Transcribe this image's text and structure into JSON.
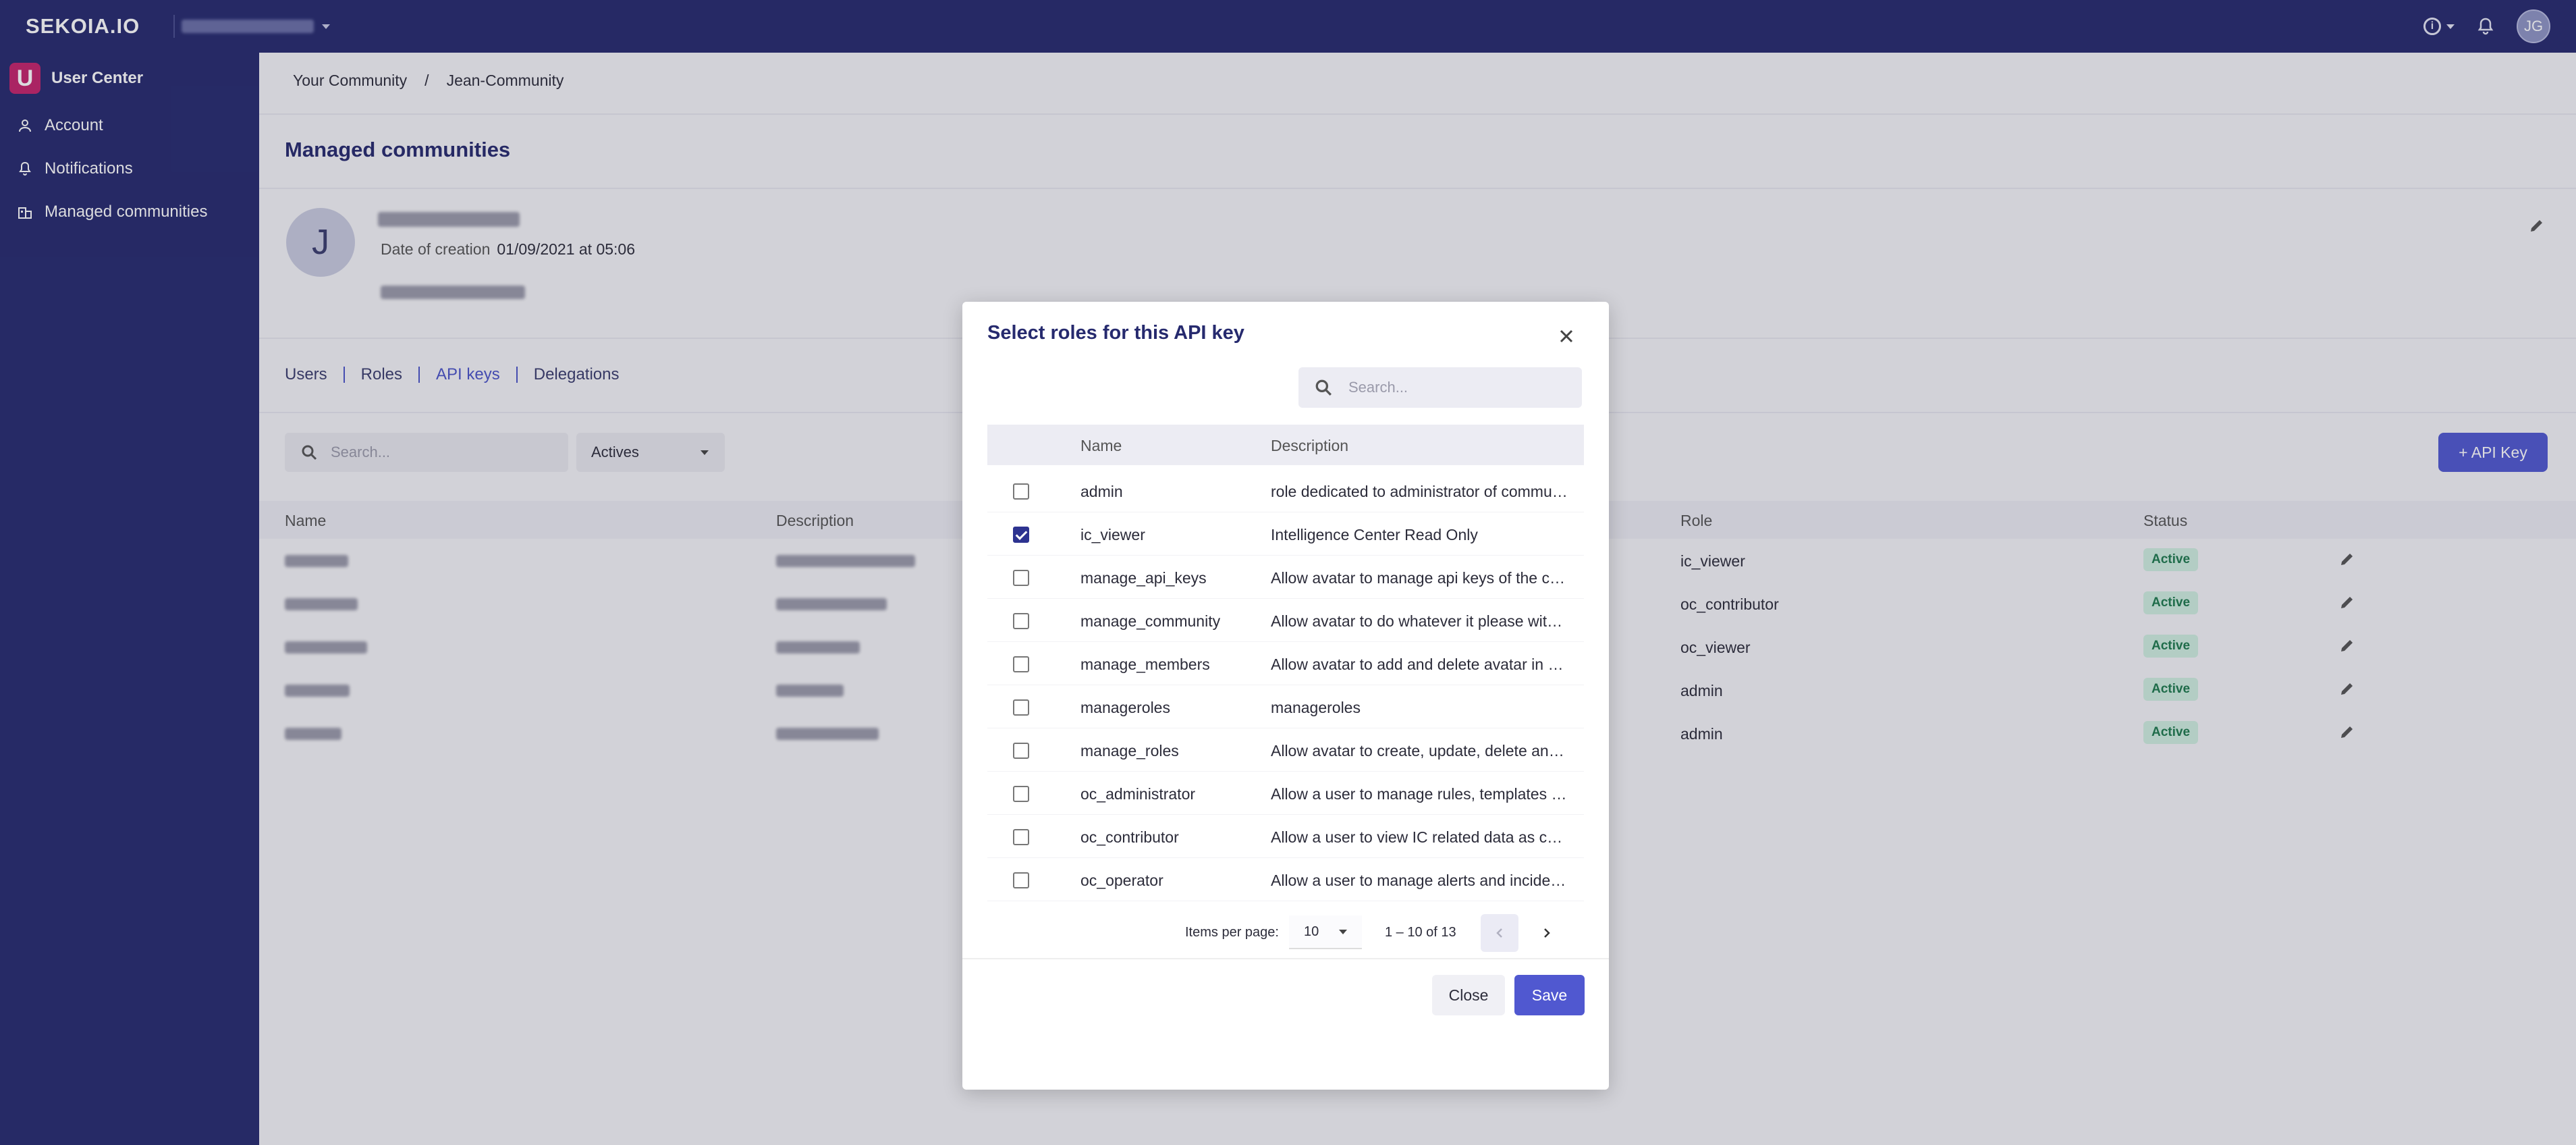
{
  "topbar": {
    "logo": "SEKOIA.IO",
    "user_initials": "JG"
  },
  "sidebar": {
    "title": "User Center",
    "logo_letter": "U",
    "items": [
      {
        "label": "Account",
        "icon": "person-icon"
      },
      {
        "label": "Notifications",
        "icon": "bell-icon"
      },
      {
        "label": "Managed communities",
        "icon": "building-icon"
      }
    ]
  },
  "breadcrumb": {
    "root": "Your Community",
    "separator": "/",
    "current": "Jean-Community"
  },
  "page": {
    "title": "Managed communities"
  },
  "community": {
    "avatar_letter": "J",
    "date_label": "Date of creation",
    "date_value": "01/09/2021 at 05:06"
  },
  "tabs": [
    {
      "label": "Users"
    },
    {
      "label": "Roles"
    },
    {
      "label": "API keys"
    },
    {
      "label": "Delegations"
    }
  ],
  "toolbar": {
    "search_placeholder": "Search...",
    "filter_value": "Actives",
    "add_label": "+ API Key"
  },
  "table": {
    "headers": {
      "name": "Name",
      "description": "Description",
      "role": "Role",
      "status": "Status"
    },
    "rows": [
      {
        "role": "ic_viewer",
        "status": "Active"
      },
      {
        "role": "oc_contributor",
        "status": "Active"
      },
      {
        "role": "oc_viewer",
        "status": "Active"
      },
      {
        "role": "admin",
        "status": "Active"
      },
      {
        "role": "admin",
        "status": "Active"
      }
    ]
  },
  "modal": {
    "title": "Select roles for this API key",
    "search_placeholder": "Search...",
    "headers": {
      "name": "Name",
      "description": "Description"
    },
    "rows": [
      {
        "name": "admin",
        "description": "role dedicated to administrator of community",
        "checked": false
      },
      {
        "name": "ic_viewer",
        "description": "Intelligence Center Read Only",
        "checked": true
      },
      {
        "name": "manage_api_keys",
        "description": "Allow avatar to manage api keys of the community",
        "checked": false
      },
      {
        "name": "manage_community",
        "description": "Allow avatar to do whatever it please with the community",
        "checked": false
      },
      {
        "name": "manage_members",
        "description": "Allow avatar to add and delete avatar in community",
        "checked": false
      },
      {
        "name": "manageroles",
        "description": "manageroles",
        "checked": false
      },
      {
        "name": "manage_roles",
        "description": "Allow avatar to create, update, delete and assign roles",
        "checked": false
      },
      {
        "name": "oc_administrator",
        "description": "Allow a user to manage rules, templates and settings",
        "checked": false
      },
      {
        "name": "oc_contributor",
        "description": "Allow a user to view IC related data as contributor",
        "checked": false
      },
      {
        "name": "oc_operator",
        "description": "Allow a user to manage alerts and incidents",
        "checked": false
      }
    ],
    "paginator": {
      "label": "Items per page:",
      "page_size": "10",
      "range": "1 – 10 of 13"
    },
    "close_label": "Close",
    "save_label": "Save"
  }
}
